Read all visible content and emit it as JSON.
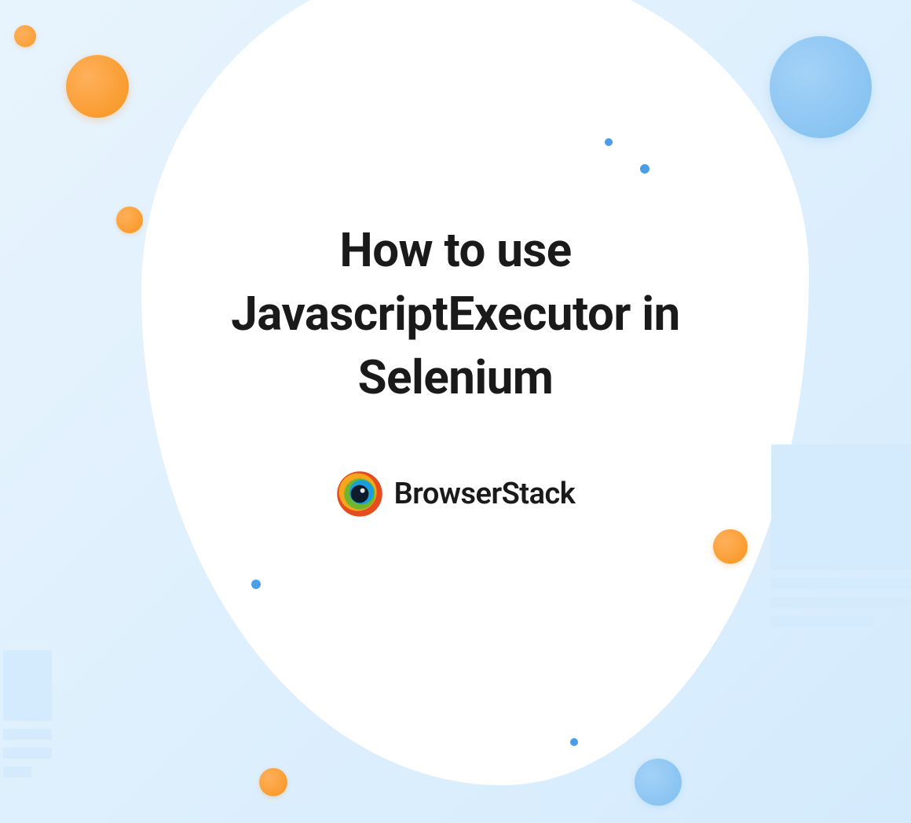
{
  "hero": {
    "title": "How to use JavascriptExecutor in Selenium"
  },
  "brand": {
    "name": "BrowserStack",
    "logo_colors": {
      "outer": "#e64c1e",
      "ring2": "#f5a61f",
      "ring3": "#6fb62e",
      "ring4": "#1a9fdd",
      "center": "#0d1b2a"
    }
  },
  "palette": {
    "bg_light": "#e8f4fd",
    "orange": "#f7941d",
    "blue": "#7ebef0",
    "blue_dot": "#4a9de8",
    "text": "#1a1a1a"
  }
}
